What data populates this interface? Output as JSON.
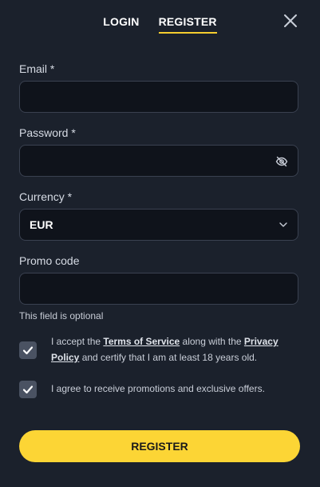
{
  "tabs": [
    {
      "label": "LOGIN",
      "active": false
    },
    {
      "label": "REGISTER",
      "active": true
    }
  ],
  "email": {
    "label": "Email *",
    "value": "",
    "placeholder": ""
  },
  "password": {
    "label": "Password *",
    "value": "",
    "placeholder": ""
  },
  "currency": {
    "label": "Currency *",
    "selected": "EUR"
  },
  "promo": {
    "label": "Promo code",
    "value": "",
    "placeholder": "",
    "helper": "This field is optional"
  },
  "terms": {
    "checked": true,
    "text_1": "I accept the ",
    "link_tos": "Terms of Service",
    "text_2": " along with the ",
    "link_privacy": "Privacy Policy",
    "text_3": " and certify that I am at least 18 years old."
  },
  "promotions": {
    "checked": true,
    "text": "I agree to receive promotions and exclusive offers."
  },
  "submit": {
    "label": "REGISTER"
  },
  "colors": {
    "accent": "#fcd535",
    "background": "#1b212c",
    "input_bg": "#0f131b"
  }
}
